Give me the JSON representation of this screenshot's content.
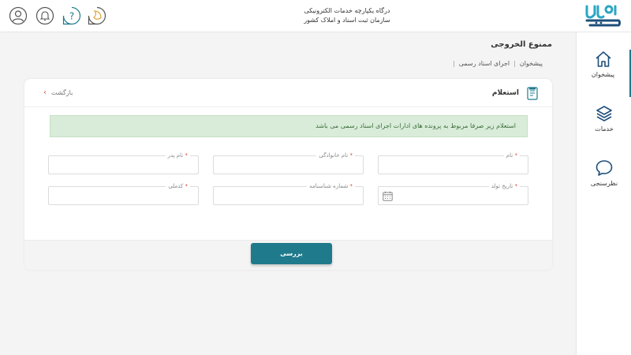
{
  "header": {
    "title_line1": "درگاه یکپارچه خدمات الکترونیکی",
    "title_line2": "سازمان ثبت اسناد و املاک کشور",
    "logo_text": "ثبت من",
    "icons": [
      "user-icon",
      "bell-icon",
      "help-icon",
      "moon-icon"
    ]
  },
  "sidebar": {
    "items": [
      {
        "label": "پیشخوان",
        "icon": "home-icon",
        "active": true
      },
      {
        "label": "خدمات",
        "icon": "layers-icon",
        "active": false
      },
      {
        "label": "نظرسنجی",
        "icon": "chat-icon",
        "active": false
      }
    ]
  },
  "page": {
    "title": "ممنوع الخروجی",
    "breadcrumb": [
      "پیشخوان",
      "اجرای اسناد رسمی"
    ]
  },
  "card": {
    "title": "استعلام",
    "back_label": "بازگشت",
    "alert": "استعلام زیر صرفا مربوط به پرونده های ادارات اجرای اسناد رسمی می باشد",
    "fields": {
      "first_name": {
        "label": "نام",
        "required": true,
        "value": ""
      },
      "last_name": {
        "label": "نام خانوادگی",
        "required": true,
        "value": ""
      },
      "father_name": {
        "label": "نام پدر",
        "required": true,
        "value": ""
      },
      "birth_date": {
        "label": "تاریخ تولد",
        "required": true,
        "value": ""
      },
      "id_number": {
        "label": "شماره شناسنامه",
        "required": true,
        "value": ""
      },
      "national_code": {
        "label": "کدملی",
        "required": true,
        "value": ""
      }
    },
    "submit_label": "بررسی"
  },
  "colors": {
    "accent": "#1f7a8c",
    "required": "#e04a3a",
    "alert_bg": "#d9ecd9",
    "alert_text": "#3c6e3c",
    "back_arrow": "#d9534f"
  }
}
